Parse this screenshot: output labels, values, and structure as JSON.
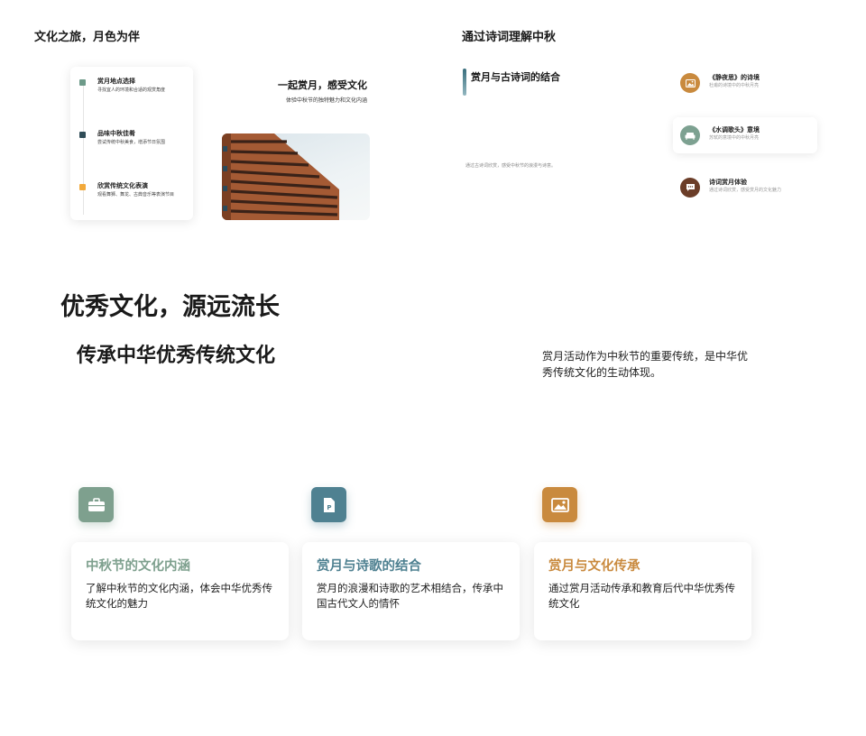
{
  "top_left": {
    "title": "文化之旅，月色为伴",
    "timeline": [
      {
        "title": "赏月地点选择",
        "desc": "寻找宜人的环境和合适的观赏角度",
        "color": "#6d9a89"
      },
      {
        "title": "品味中秋佳肴",
        "desc": "尝试传统中秋美食，增添节日氛围",
        "color": "#2f4c57"
      },
      {
        "title": "欣赏传统文化表演",
        "desc": "观看舞狮、舞龙、古典音乐等表演节目",
        "color": "#f2a93b"
      }
    ],
    "hero_title": "一起赏月，感受文化",
    "hero_subtitle": "体验中秋节的独特魅力和文化内涵"
  },
  "top_right": {
    "title": "通过诗词理解中秋",
    "heading": "赏月与古诗词的结合",
    "note": "通过古诗词欣赏，感受中秋节的浪漫与诗意。",
    "items": [
      {
        "title": "《静夜思》的诗境",
        "desc": "杜甫的诗境中的中秋月亮",
        "icon": "image-icon",
        "color": "#c98a3e"
      },
      {
        "title": "《水调歌头》意境",
        "desc": "苏轼的意境中的中秋月亮",
        "icon": "sofa-icon",
        "color": "#7da191"
      },
      {
        "title": "诗词赏月体验",
        "desc": "通过诗词欣赏，感受赏月的文化魅力",
        "icon": "chat-icon",
        "color": "#6b3d28"
      }
    ]
  },
  "middle": {
    "title": "优秀文化，源远流长",
    "subtitle": "传承中华优秀传统文化",
    "description": "赏月活动作为中秋节的重要传统，是中华优秀传统文化的生动体现。"
  },
  "cards": [
    {
      "title": "中秋节的文化内涵",
      "desc": "了解中秋节的文化内涵，体会中华优秀传统文化的魅力",
      "icon": "briefcase-icon",
      "color": "#7ea08e"
    },
    {
      "title": "赏月与诗歌的结合",
      "desc": "赏月的浪漫和诗歌的艺术相结合，传承中国古代文人的情怀",
      "icon": "document-icon",
      "color": "#4f8191"
    },
    {
      "title": "赏月与文化传承",
      "desc": "通过赏月活动传承和教育后代中华优秀传统文化",
      "icon": "image-icon",
      "color": "#c98a3e"
    }
  ]
}
